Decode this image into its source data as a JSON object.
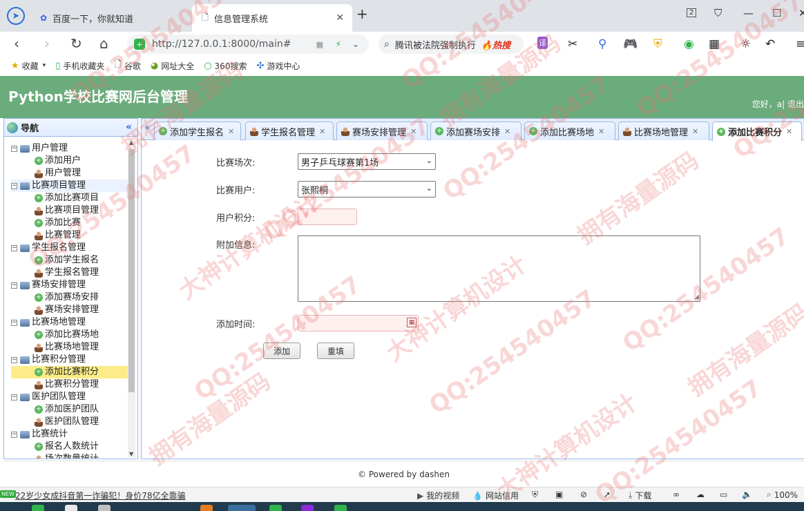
{
  "browser": {
    "tabs": [
      {
        "label": "百度一下，你就知道",
        "icon": "baidu-paw-icon"
      },
      {
        "label": "信息管理系统",
        "icon": "page-icon"
      }
    ],
    "tab_count": "2",
    "url": "http://127.0.0.1:8000/main#",
    "search_text": "腾讯被法院强制执行",
    "search_hot": "热搜",
    "translate": "译",
    "bookmarks": [
      "收藏",
      "手机收藏夹",
      "谷歌",
      "网址大全",
      "360搜索",
      "游戏中心"
    ]
  },
  "app": {
    "title": "Python学校比赛网后台管理",
    "greeting": "您好，a| 退出",
    "accent_color": "#6aac7c"
  },
  "sidebar": {
    "title": "导航",
    "groups": [
      {
        "label": "用户管理",
        "items": [
          {
            "label": "添加用户",
            "icon": "add"
          },
          {
            "label": "用户管理",
            "icon": "user"
          }
        ]
      },
      {
        "label": "比赛项目管理",
        "items": [
          {
            "label": "添加比赛项目",
            "icon": "add"
          },
          {
            "label": "比赛项目管理",
            "icon": "user"
          },
          {
            "label": "添加比赛",
            "icon": "add"
          },
          {
            "label": "比赛管理",
            "icon": "user"
          }
        ]
      },
      {
        "label": "学生报名管理",
        "items": [
          {
            "label": "添加学生报名",
            "icon": "add"
          },
          {
            "label": "学生报名管理",
            "icon": "user"
          }
        ]
      },
      {
        "label": "赛场安排管理",
        "items": [
          {
            "label": "添加赛场安排",
            "icon": "add"
          },
          {
            "label": "赛场安排管理",
            "icon": "user"
          }
        ]
      },
      {
        "label": "比赛场地管理",
        "items": [
          {
            "label": "添加比赛场地",
            "icon": "add"
          },
          {
            "label": "比赛场地管理",
            "icon": "user"
          }
        ]
      },
      {
        "label": "比赛积分管理",
        "items": [
          {
            "label": "添加比赛积分",
            "icon": "add"
          },
          {
            "label": "比赛积分管理",
            "icon": "user"
          }
        ]
      },
      {
        "label": "医护团队管理",
        "items": [
          {
            "label": "添加医护团队",
            "icon": "add"
          },
          {
            "label": "医护团队管理",
            "icon": "user"
          }
        ]
      },
      {
        "label": "比赛统计",
        "items": [
          {
            "label": "报名人数统计",
            "icon": "add"
          },
          {
            "label": "场次数量统计",
            "icon": "user"
          }
        ]
      }
    ]
  },
  "content_tabs": [
    {
      "label": "添加学生报名",
      "icon": "add"
    },
    {
      "label": "学生报名管理",
      "icon": "user"
    },
    {
      "label": "赛场安排管理",
      "icon": "user"
    },
    {
      "label": "添加赛场安排",
      "icon": "add"
    },
    {
      "label": "添加比赛场地",
      "icon": "add"
    },
    {
      "label": "比赛场地管理",
      "icon": "user"
    },
    {
      "label": "添加比赛积分",
      "icon": "add"
    }
  ],
  "form": {
    "match_label": "比赛场次:",
    "match_value": "男子乒乓球赛第1场",
    "user_label": "比赛用户:",
    "user_value": "张熙桐",
    "score_label": "用户积分:",
    "score_value": "",
    "extra_label": "附加信息:",
    "extra_value": "",
    "time_label": "添加时间:",
    "time_value": "",
    "submit": "添加",
    "reset": "重填"
  },
  "footer": "© Powered by dashen",
  "statusbar": {
    "news": "22岁少女成抖音第一诈骗犯！身价78亿全靠骗",
    "new_badge": "NEW",
    "video": "我的视频",
    "site_credit": "网站信用",
    "download": "下载",
    "zoom": "100%"
  },
  "watermarks": [
    "QQ:254540457",
    "大神计算机设计",
    "拥有海量源码"
  ]
}
